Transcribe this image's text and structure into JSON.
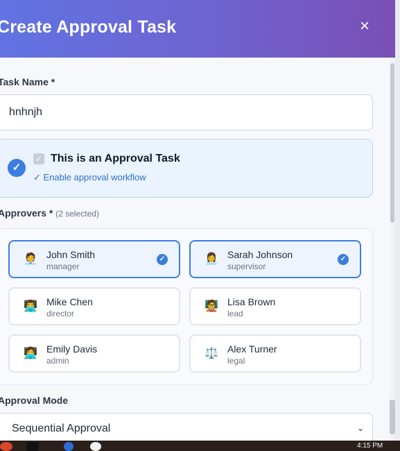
{
  "modal": {
    "title": "Create Approval Task",
    "close_icon": "×"
  },
  "task_name": {
    "label": "Task Name *",
    "value": "hnhnjh"
  },
  "approval": {
    "circle_icon": "✓",
    "checkbox_icon": "✓",
    "title": "This is an Approval Task",
    "subtitle": "✓ Enable approval workflow",
    "checked": true
  },
  "approvers": {
    "label": "Approvers *",
    "count": "(2 selected)",
    "people": [
      {
        "name": "John Smith",
        "role": "manager",
        "avatar": "🧑‍💼",
        "selected": true
      },
      {
        "name": "Sarah Johnson",
        "role": "supervisor",
        "avatar": "👩‍💼",
        "selected": true
      },
      {
        "name": "Mike Chen",
        "role": "director",
        "avatar": "👨‍💻",
        "selected": false
      },
      {
        "name": "Lisa Brown",
        "role": "lead",
        "avatar": "🧑‍🏫",
        "selected": false
      },
      {
        "name": "Emily Davis",
        "role": "admin",
        "avatar": "👩‍💻",
        "selected": false
      },
      {
        "name": "Alex Turner",
        "role": "legal",
        "avatar": "⚖️",
        "selected": false
      }
    ],
    "tick_icon": "✓"
  },
  "approval_mode": {
    "label": "Approval Mode",
    "value": "Sequential Approval",
    "chevron_icon": "⌄"
  },
  "taskbar": {
    "clock": "4:15 PM"
  },
  "colors": {
    "header_gradient_start": "#6173e3",
    "header_gradient_end": "#7a4fb5",
    "accent": "#3b7de0"
  }
}
